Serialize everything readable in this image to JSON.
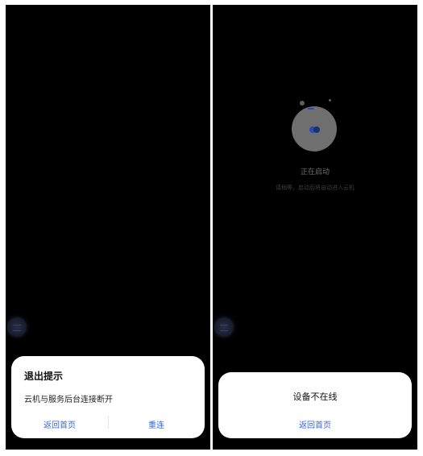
{
  "left_screen": {
    "dialog": {
      "title": "退出提示",
      "message": "云机与服务后台连接断开",
      "home_label": "返回首页",
      "retry_label": "重连"
    }
  },
  "right_screen": {
    "loading": {
      "status": "正在启动",
      "hint": "请稍等，启动后将自动进入云机"
    },
    "dialog": {
      "message": "设备不在线",
      "home_label": "返回首页"
    }
  },
  "colors": {
    "accent": "#3366e0",
    "background": "#000000",
    "sheet": "#ffffff"
  },
  "icons": [
    "float-ball-icon",
    "loading-spinner-icon"
  ]
}
